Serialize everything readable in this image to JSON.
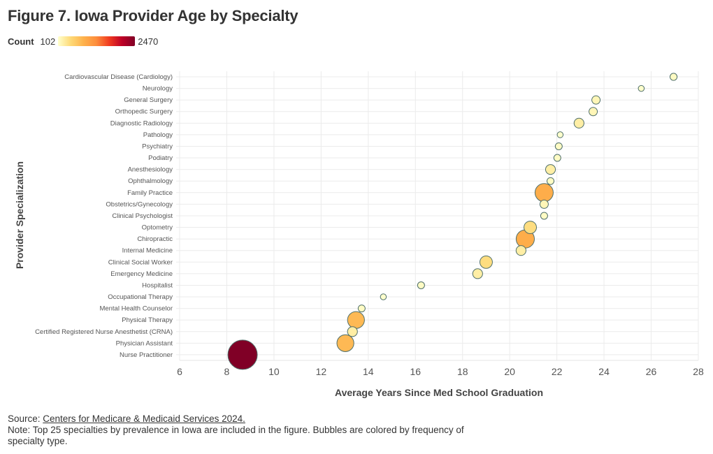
{
  "title": "Figure 7. Iowa Provider Age by Specialty",
  "legend": {
    "label": "Count",
    "min": "102",
    "max": "2470",
    "colors": [
      "#ffffcc",
      "#fed976",
      "#feb24c",
      "#fd8d3c",
      "#f03b20",
      "#bd0026",
      "#800026"
    ]
  },
  "footer": {
    "source_prefix": "Source: ",
    "source_link": "Centers for Medicare & Medicaid Services 2024.",
    "note": "Note: Top 25 specialties by prevalence in Iowa are included in the figure. Bubbles are colored by frequency of specialty type."
  },
  "chart_data": {
    "type": "scatter",
    "subtype": "bubble",
    "title": "Figure 7. Iowa Provider Age by Specialty",
    "xlabel": "Average Years Since Med School Graduation",
    "ylabel": "Provider Specialization",
    "xlim": [
      6,
      28
    ],
    "xticks": [
      "6",
      "8",
      "10",
      "12",
      "14",
      "16",
      "18",
      "20",
      "22",
      "24",
      "26",
      "28"
    ],
    "grid": true,
    "size_and_color_by": "Count",
    "count_range": [
      102,
      2470
    ],
    "categories": [
      "Cardiovascular Disease (Cardiology)",
      "Neurology",
      "General Surgery",
      "Orthopedic Surgery",
      "Diagnostic Radiology",
      "Pathology",
      "Psychiatry",
      "Podiatry",
      "Anesthesiology",
      "Ophthalmology",
      "Family Practice",
      "Obstetrics/Gynecology",
      "Clinical Psychologist",
      "Optometry",
      "Chiropractic",
      "Internal Medicine",
      "Clinical Social Worker",
      "Emergency Medicine",
      "Hospitalist",
      "Occupational Therapy",
      "Mental Health Counselor",
      "Physical Therapy",
      "Certified Registered Nurse Anesthetist (CRNA)",
      "Physician Assistant",
      "Nurse Practitioner"
    ],
    "x": [
      26.95,
      25.58,
      23.66,
      23.54,
      22.94,
      22.14,
      22.08,
      22.02,
      21.73,
      21.73,
      21.46,
      21.46,
      21.46,
      20.87,
      20.66,
      20.48,
      19.0,
      18.64,
      16.24,
      14.64,
      13.72,
      13.48,
      13.33,
      13.03,
      8.67
    ],
    "count": [
      145,
      102,
      200,
      200,
      280,
      102,
      140,
      140,
      280,
      140,
      950,
      200,
      140,
      450,
      950,
      280,
      450,
      280,
      140,
      102,
      140,
      820,
      280,
      820,
      2470
    ]
  }
}
